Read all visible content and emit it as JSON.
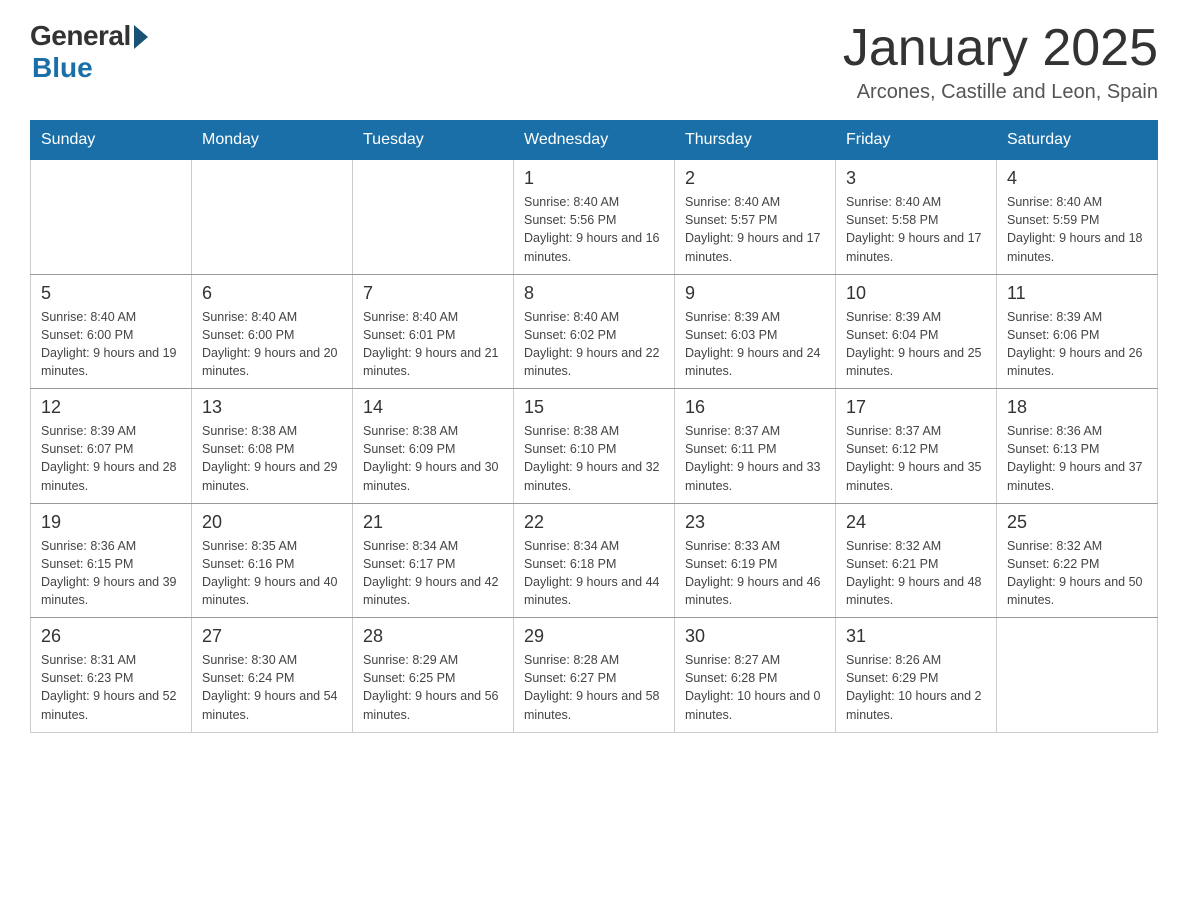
{
  "header": {
    "logo_general": "General",
    "logo_blue": "Blue",
    "month_title": "January 2025",
    "location": "Arcones, Castille and Leon, Spain"
  },
  "days_of_week": [
    "Sunday",
    "Monday",
    "Tuesday",
    "Wednesday",
    "Thursday",
    "Friday",
    "Saturday"
  ],
  "weeks": [
    [
      {
        "day": "",
        "info": ""
      },
      {
        "day": "",
        "info": ""
      },
      {
        "day": "",
        "info": ""
      },
      {
        "day": "1",
        "info": "Sunrise: 8:40 AM\nSunset: 5:56 PM\nDaylight: 9 hours\nand 16 minutes."
      },
      {
        "day": "2",
        "info": "Sunrise: 8:40 AM\nSunset: 5:57 PM\nDaylight: 9 hours\nand 17 minutes."
      },
      {
        "day": "3",
        "info": "Sunrise: 8:40 AM\nSunset: 5:58 PM\nDaylight: 9 hours\nand 17 minutes."
      },
      {
        "day": "4",
        "info": "Sunrise: 8:40 AM\nSunset: 5:59 PM\nDaylight: 9 hours\nand 18 minutes."
      }
    ],
    [
      {
        "day": "5",
        "info": "Sunrise: 8:40 AM\nSunset: 6:00 PM\nDaylight: 9 hours\nand 19 minutes."
      },
      {
        "day": "6",
        "info": "Sunrise: 8:40 AM\nSunset: 6:00 PM\nDaylight: 9 hours\nand 20 minutes."
      },
      {
        "day": "7",
        "info": "Sunrise: 8:40 AM\nSunset: 6:01 PM\nDaylight: 9 hours\nand 21 minutes."
      },
      {
        "day": "8",
        "info": "Sunrise: 8:40 AM\nSunset: 6:02 PM\nDaylight: 9 hours\nand 22 minutes."
      },
      {
        "day": "9",
        "info": "Sunrise: 8:39 AM\nSunset: 6:03 PM\nDaylight: 9 hours\nand 24 minutes."
      },
      {
        "day": "10",
        "info": "Sunrise: 8:39 AM\nSunset: 6:04 PM\nDaylight: 9 hours\nand 25 minutes."
      },
      {
        "day": "11",
        "info": "Sunrise: 8:39 AM\nSunset: 6:06 PM\nDaylight: 9 hours\nand 26 minutes."
      }
    ],
    [
      {
        "day": "12",
        "info": "Sunrise: 8:39 AM\nSunset: 6:07 PM\nDaylight: 9 hours\nand 28 minutes."
      },
      {
        "day": "13",
        "info": "Sunrise: 8:38 AM\nSunset: 6:08 PM\nDaylight: 9 hours\nand 29 minutes."
      },
      {
        "day": "14",
        "info": "Sunrise: 8:38 AM\nSunset: 6:09 PM\nDaylight: 9 hours\nand 30 minutes."
      },
      {
        "day": "15",
        "info": "Sunrise: 8:38 AM\nSunset: 6:10 PM\nDaylight: 9 hours\nand 32 minutes."
      },
      {
        "day": "16",
        "info": "Sunrise: 8:37 AM\nSunset: 6:11 PM\nDaylight: 9 hours\nand 33 minutes."
      },
      {
        "day": "17",
        "info": "Sunrise: 8:37 AM\nSunset: 6:12 PM\nDaylight: 9 hours\nand 35 minutes."
      },
      {
        "day": "18",
        "info": "Sunrise: 8:36 AM\nSunset: 6:13 PM\nDaylight: 9 hours\nand 37 minutes."
      }
    ],
    [
      {
        "day": "19",
        "info": "Sunrise: 8:36 AM\nSunset: 6:15 PM\nDaylight: 9 hours\nand 39 minutes."
      },
      {
        "day": "20",
        "info": "Sunrise: 8:35 AM\nSunset: 6:16 PM\nDaylight: 9 hours\nand 40 minutes."
      },
      {
        "day": "21",
        "info": "Sunrise: 8:34 AM\nSunset: 6:17 PM\nDaylight: 9 hours\nand 42 minutes."
      },
      {
        "day": "22",
        "info": "Sunrise: 8:34 AM\nSunset: 6:18 PM\nDaylight: 9 hours\nand 44 minutes."
      },
      {
        "day": "23",
        "info": "Sunrise: 8:33 AM\nSunset: 6:19 PM\nDaylight: 9 hours\nand 46 minutes."
      },
      {
        "day": "24",
        "info": "Sunrise: 8:32 AM\nSunset: 6:21 PM\nDaylight: 9 hours\nand 48 minutes."
      },
      {
        "day": "25",
        "info": "Sunrise: 8:32 AM\nSunset: 6:22 PM\nDaylight: 9 hours\nand 50 minutes."
      }
    ],
    [
      {
        "day": "26",
        "info": "Sunrise: 8:31 AM\nSunset: 6:23 PM\nDaylight: 9 hours\nand 52 minutes."
      },
      {
        "day": "27",
        "info": "Sunrise: 8:30 AM\nSunset: 6:24 PM\nDaylight: 9 hours\nand 54 minutes."
      },
      {
        "day": "28",
        "info": "Sunrise: 8:29 AM\nSunset: 6:25 PM\nDaylight: 9 hours\nand 56 minutes."
      },
      {
        "day": "29",
        "info": "Sunrise: 8:28 AM\nSunset: 6:27 PM\nDaylight: 9 hours\nand 58 minutes."
      },
      {
        "day": "30",
        "info": "Sunrise: 8:27 AM\nSunset: 6:28 PM\nDaylight: 10 hours\nand 0 minutes."
      },
      {
        "day": "31",
        "info": "Sunrise: 8:26 AM\nSunset: 6:29 PM\nDaylight: 10 hours\nand 2 minutes."
      },
      {
        "day": "",
        "info": ""
      }
    ]
  ]
}
